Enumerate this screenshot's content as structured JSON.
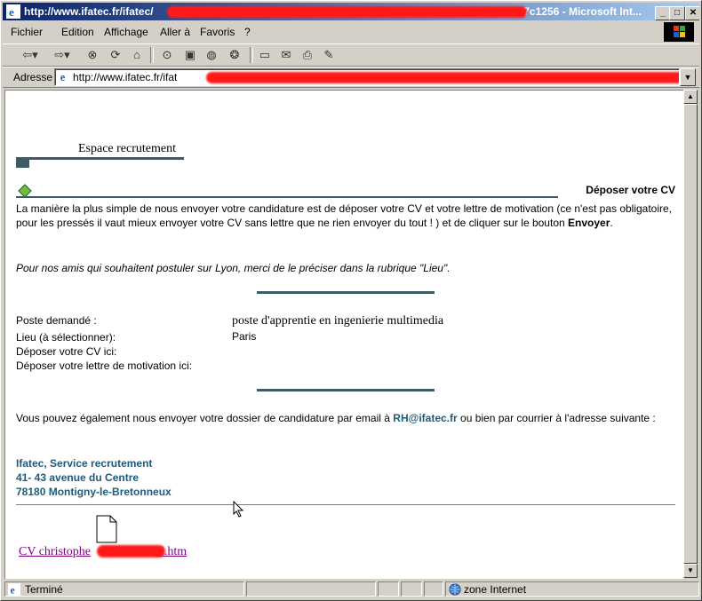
{
  "window": {
    "title_prefix": "http://www.ifatec.fr/ifatec/",
    "title_suffix": "a7c1256 - Microsoft Int...",
    "controls": [
      "_",
      "□",
      "✕"
    ]
  },
  "menu": [
    "Fichier",
    "Edition",
    "Affichage",
    "Aller à",
    "Favoris",
    "?"
  ],
  "toolbar_icons": [
    "back-icon",
    "forward-icon",
    "stop-icon",
    "refresh-icon",
    "home-icon",
    "search-icon",
    "favorites-icon",
    "history-icon",
    "channels-icon",
    "fullscreen-icon",
    "mail-icon",
    "print-icon",
    "edit-icon"
  ],
  "address": {
    "label": "Adresse",
    "url_prefix": "http://www.ifatec.fr/ifat",
    "url_suffix": "nt"
  },
  "page": {
    "section_title": "Espace recrutement",
    "heading": "Déposer votre CV",
    "intro_text": "La manière la plus simple de nous envoyer votre candidature est de déposer votre CV et votre lettre de motivation (ce n'est pas obligatoire, pour les pressés il vaut mieux envoyer votre CV sans lettre que ne rien envoyer du tout ! ) et de cliquer sur le bouton",
    "intro_bold": "Envoyer",
    "intro_end": ".",
    "lyon_note": "Pour nos amis qui souhaitent postuler sur Lyon, merci de le préciser dans la rubrique \"Lieu\".",
    "form": [
      {
        "label": "Poste demandé :",
        "value": "poste d'apprentie en ingenierie multimedia"
      },
      {
        "label": "Lieu (à sélectionner):",
        "value": "Paris"
      },
      {
        "label": "Déposer votre CV ici:",
        "value": ""
      },
      {
        "label": "Déposer votre lettre de motivation ici:",
        "value": ""
      }
    ],
    "email_text_before": "Vous pouvez également nous envoyer votre dossier de candidature par email à",
    "email": "RH@ifatec.fr",
    "email_text_after": "ou bien par courrier à l'adresse suivante :",
    "address_lines": [
      "Ifatec, Service recrutement",
      "41- 43 avenue du Centre",
      "78180 Montigny-le-Bretonneux"
    ],
    "attachment_prefix": "CV christophe",
    "attachment_suffix": "nl.htm"
  },
  "status": {
    "text": "Terminé",
    "zone": "zone Internet"
  },
  "colors": {
    "accent_bar": "#3f5c66",
    "teal_text": "#1e5a7a",
    "link": "#800080"
  }
}
